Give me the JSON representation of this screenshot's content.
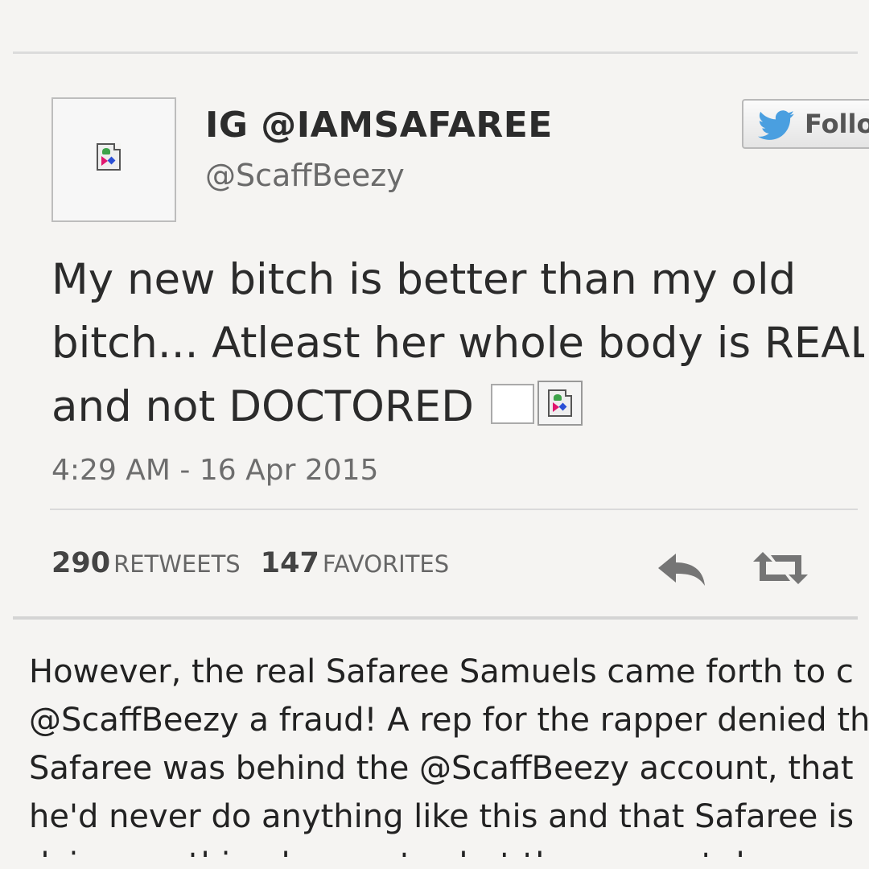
{
  "tweet": {
    "display_name": "IG @IAMSAFAREE",
    "handle": "@ScaffBeezy",
    "follow_label": "Follow",
    "text_lines": [
      "My new bitch is better than my old",
      "bitch... Atleast her whole body is REAL",
      "and not DOCTORED"
    ],
    "timestamp": "4:29 AM - 16 Apr 2015",
    "retweets_count": "290",
    "retweets_label": "RETWEETS",
    "favorites_count": "147",
    "favorites_label": "FAVORITES",
    "icons": [
      "broken-image-icon",
      "twitter-bird-icon",
      "reply-icon",
      "retweet-icon"
    ],
    "colors": {
      "twitter_blue": "#4a9fe0",
      "icon_gray": "#757575"
    }
  },
  "article": {
    "lines": [
      "However, the real Safaree Samuels came forth to c",
      "@ScaffBeezy a fraud! A rep for the rapper denied th",
      "Safaree was behind the @ScaffBeezy account, that",
      "he'd never do anything like this and that Safaree is",
      "doing anything he can to shut the account down"
    ]
  }
}
